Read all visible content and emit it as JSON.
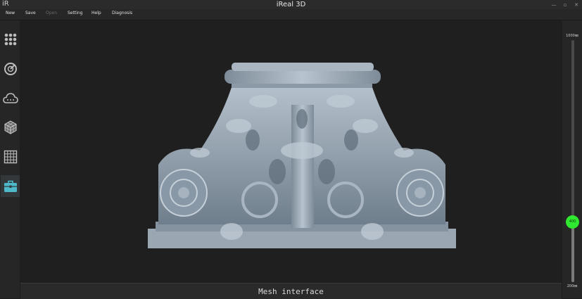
{
  "window": {
    "logo": "iR",
    "title": "iReal 3D",
    "controls": [
      "—",
      "▫",
      "✕"
    ]
  },
  "menu": [
    {
      "label": "New",
      "enabled": true
    },
    {
      "label": "Save",
      "enabled": true
    },
    {
      "label": "Open",
      "enabled": false
    },
    {
      "label": "Setting",
      "enabled": true
    },
    {
      "label": "Help",
      "enabled": true
    },
    {
      "label": "Diagnosis",
      "enabled": true
    }
  ],
  "toolbar": [
    {
      "icon": "dots-grid-icon",
      "active": false
    },
    {
      "icon": "radar-scan-icon",
      "active": false
    },
    {
      "icon": "cloud-icon",
      "active": false
    },
    {
      "icon": "cube-mesh-icon",
      "active": false
    },
    {
      "icon": "grid-icon",
      "active": false
    },
    {
      "icon": "toolbox-icon",
      "active": true
    }
  ],
  "distance_slider": {
    "max_label": "1000㎜",
    "min_label": "200㎜",
    "value": "400",
    "max": 1000,
    "min": 200,
    "current": 400
  },
  "status": {
    "text": "Mesh interface"
  },
  "colors": {
    "accent": "#2fe82f",
    "active_tool": "#4fb8c9",
    "model": "#8f9fae"
  }
}
